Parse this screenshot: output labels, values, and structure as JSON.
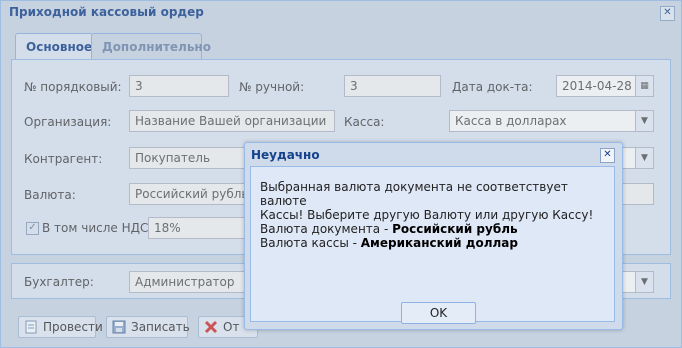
{
  "window": {
    "title": "Приходной кассовый ордер"
  },
  "tabs": [
    {
      "label": "Основное"
    },
    {
      "label": "Дополнительно"
    }
  ],
  "form": {
    "num_seq_label": "№ порядковый:",
    "num_seq_value": "3",
    "num_manual_label": "№ ручной:",
    "num_manual_value": "3",
    "date_label": "Дата док-та:",
    "date_value": "2014-04-28",
    "org_label": "Организация:",
    "org_value": "Название Вашей организации",
    "cash_label": "Касса:",
    "cash_value": "Касса в долларах",
    "contractor_label": "Контрагент:",
    "contractor_value": "Покупатель",
    "currency_label": "Валюта:",
    "currency_value": "Российский рубль",
    "vat_label": "В том числе НДС",
    "vat_value": "18%",
    "accountant_label": "Бухгалтер:",
    "accountant_value": "Администратор"
  },
  "toolbar": {
    "post_label": "Провести",
    "save_label": "Записать",
    "cancel_label": "От"
  },
  "dialog": {
    "title": "Неудачно",
    "line1": "Выбранная валюта документа не соответствует валюте",
    "line2": "Кассы! Выберите другую Валюту или другую Кассу!",
    "doc_currency_prefix": "Валюта документа - ",
    "doc_currency_value": "Российский рубль",
    "cash_currency_prefix": "Валюта кассы - ",
    "cash_currency_value": "Американский доллар",
    "ok_label": "OK"
  },
  "colors": {
    "title": "#15428b",
    "panel": "#dfe8f6",
    "border": "#99bbe8"
  }
}
